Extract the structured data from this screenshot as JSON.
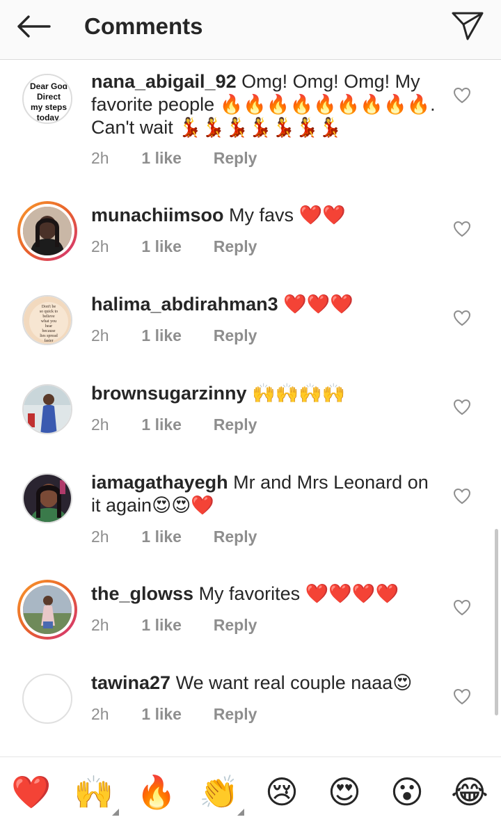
{
  "header": {
    "title": "Comments"
  },
  "comments": [
    {
      "username": "nana_abigail_92",
      "text": "Omg! Omg! Omg! My favorite people 🔥🔥🔥🔥🔥🔥🔥🔥🔥. Can't wait 💃💃💃💃💃💃💃",
      "time": "2h",
      "likes": "1 like",
      "reply": "Reply",
      "avatar": {
        "style": "text",
        "text": "Dear God Direct my steps today."
      }
    },
    {
      "username": "munachiimsoo",
      "text": "My favs ❤️❤️",
      "time": "2h",
      "likes": "1 like",
      "reply": "Reply",
      "avatar": {
        "style": "story-ring",
        "tone": "#3a2a2a"
      }
    },
    {
      "username": "halima_abdirahman3",
      "text": "❤️❤️❤️",
      "time": "2h",
      "likes": "1 like",
      "reply": "Reply",
      "avatar": {
        "style": "quote",
        "text": "Don't be so quick to believe what you hear because lies spread faster than the truth."
      }
    },
    {
      "username": "brownsugarzinny",
      "text": "🙌🙌🙌🙌",
      "time": "2h",
      "likes": "1 like",
      "reply": "Reply",
      "avatar": {
        "style": "photo",
        "tone": "#5a78b8"
      }
    },
    {
      "username": "iamagathayegh",
      "text": "Mr and Mrs Leonard on it again😍😍❤️",
      "time": "2h",
      "likes": "1 like",
      "reply": "Reply",
      "avatar": {
        "style": "photo",
        "tone": "#2e2a3a"
      }
    },
    {
      "username": "the_glowss",
      "text": "My favorites ❤️❤️❤️❤️",
      "time": "2h",
      "likes": "1 like",
      "reply": "Reply",
      "avatar": {
        "style": "story-ring",
        "tone": "#7d8a9a"
      }
    },
    {
      "username": "tawina27",
      "text": "We want real couple naaa😍",
      "time": "2h",
      "likes": "1 like",
      "reply": "Reply",
      "avatar": {
        "style": "empty"
      }
    }
  ],
  "quick_reactions": [
    "❤️",
    "🙌",
    "🔥",
    "👏",
    "😢",
    "😍",
    "😮",
    "😂"
  ],
  "colors": {
    "text_primary": "#262626",
    "text_secondary": "#8e8e8e",
    "header_bg": "#fafafa",
    "story_ring": [
      "#f99a2b",
      "#e8622c",
      "#d12e7c"
    ]
  }
}
